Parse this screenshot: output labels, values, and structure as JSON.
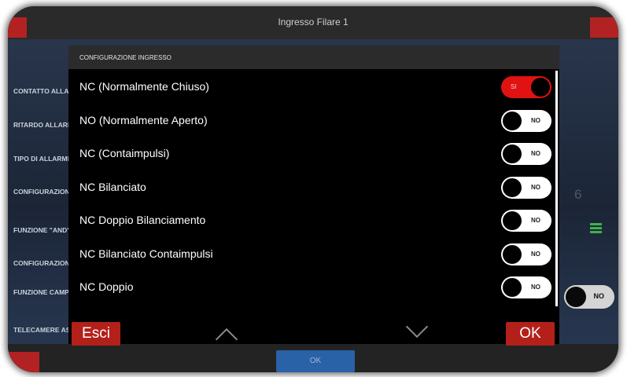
{
  "window": {
    "title": "Ingresso Filare 1"
  },
  "background": {
    "labels": [
      "CONTATTO ALLARME / TIPO DI SEGNALAZIONE",
      "RITARDO ALLARME (SEC)",
      "TIPO DI ALLARME",
      "CONFIGURAZIONE INGRESSO",
      "FUNZIONE \"AND\"",
      "CONFIGURAZIONE",
      "FUNZIONE CAMPANELLO (C",
      "TELECAMERE AS"
    ],
    "value_six": "6",
    "toggle_label": "NO",
    "ok_label": "OK"
  },
  "dialog": {
    "title": "CONFIGURAZIONE INGRESSO",
    "options": [
      {
        "label": "NC (Normalmente Chiuso)",
        "state": "SI",
        "on": true
      },
      {
        "label": "NO (Normalmente Aperto)",
        "state": "NO",
        "on": false
      },
      {
        "label": "NC (Contaimpulsi)",
        "state": "NO",
        "on": false
      },
      {
        "label": "NC Bilanciato",
        "state": "NO",
        "on": false
      },
      {
        "label": "NC Doppio Bilanciamento",
        "state": "NO",
        "on": false
      },
      {
        "label": "NC Bilanciato Contaimpulsi",
        "state": "NO",
        "on": false
      },
      {
        "label": "NC Doppio",
        "state": "NO",
        "on": false
      }
    ],
    "cancel_label": "Esci",
    "ok_label": "OK"
  },
  "colors": {
    "accent_red": "#e01212",
    "button_red": "#b3201a",
    "menu_green": "#3fb24a"
  },
  "icons": [
    "chevron-up-icon",
    "chevron-down-icon",
    "menu-icon"
  ]
}
